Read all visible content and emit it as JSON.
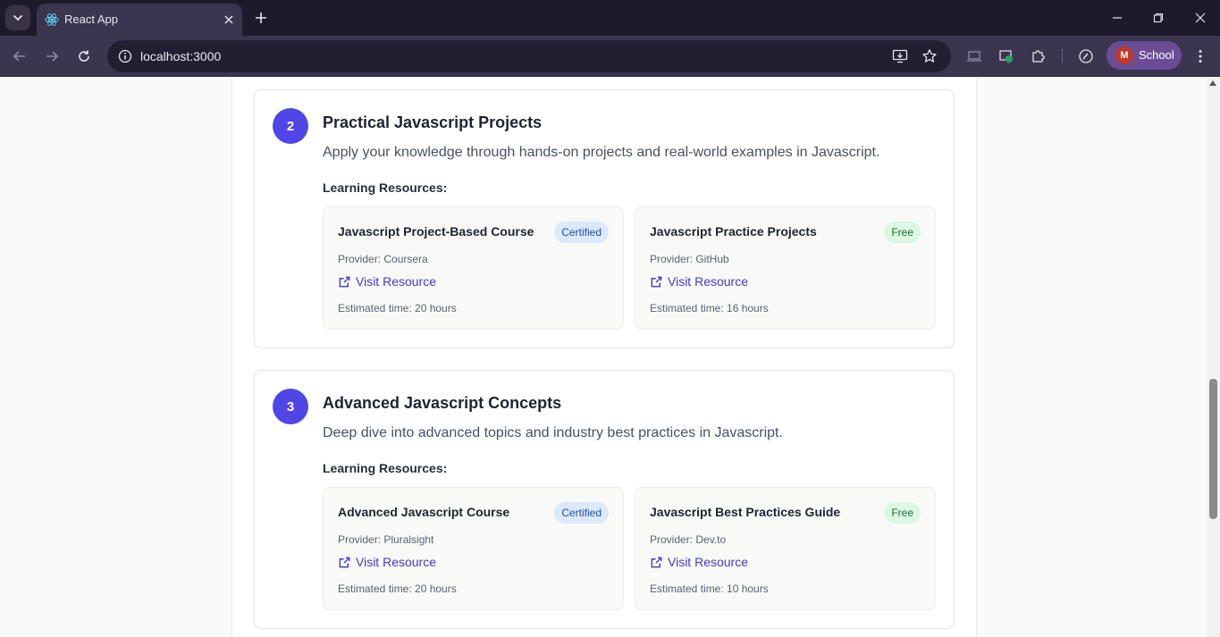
{
  "browser": {
    "tab_title": "React App",
    "url": "localhost:3000",
    "profile_initial": "M",
    "profile_name": "School"
  },
  "colors": {
    "accent": "#4f46e5",
    "link": "#4338ca",
    "certified_bg": "#dce8fb",
    "free_bg": "#dcf7e4"
  },
  "steps": [
    {
      "number": "2",
      "title": "Practical Javascript Projects",
      "description": "Apply your knowledge through hands-on projects and real-world examples in Javascript.",
      "resources_heading": "Learning Resources:",
      "resources": [
        {
          "title": "Javascript Project-Based Course",
          "badge": "Certified",
          "provider": "Provider: Coursera",
          "link_label": "Visit Resource",
          "time": "Estimated time: 20 hours"
        },
        {
          "title": "Javascript Practice Projects",
          "badge": "Free",
          "provider": "Provider: GitHub",
          "link_label": "Visit Resource",
          "time": "Estimated time: 16 hours"
        }
      ]
    },
    {
      "number": "3",
      "title": "Advanced Javascript Concepts",
      "description": "Deep dive into advanced topics and industry best practices in Javascript.",
      "resources_heading": "Learning Resources:",
      "resources": [
        {
          "title": "Advanced Javascript Course",
          "badge": "Certified",
          "provider": "Provider: Pluralsight",
          "link_label": "Visit Resource",
          "time": "Estimated time: 20 hours"
        },
        {
          "title": "Javascript Best Practices Guide",
          "badge": "Free",
          "provider": "Provider: Dev.to",
          "link_label": "Visit Resource",
          "time": "Estimated time: 10 hours"
        }
      ]
    }
  ]
}
